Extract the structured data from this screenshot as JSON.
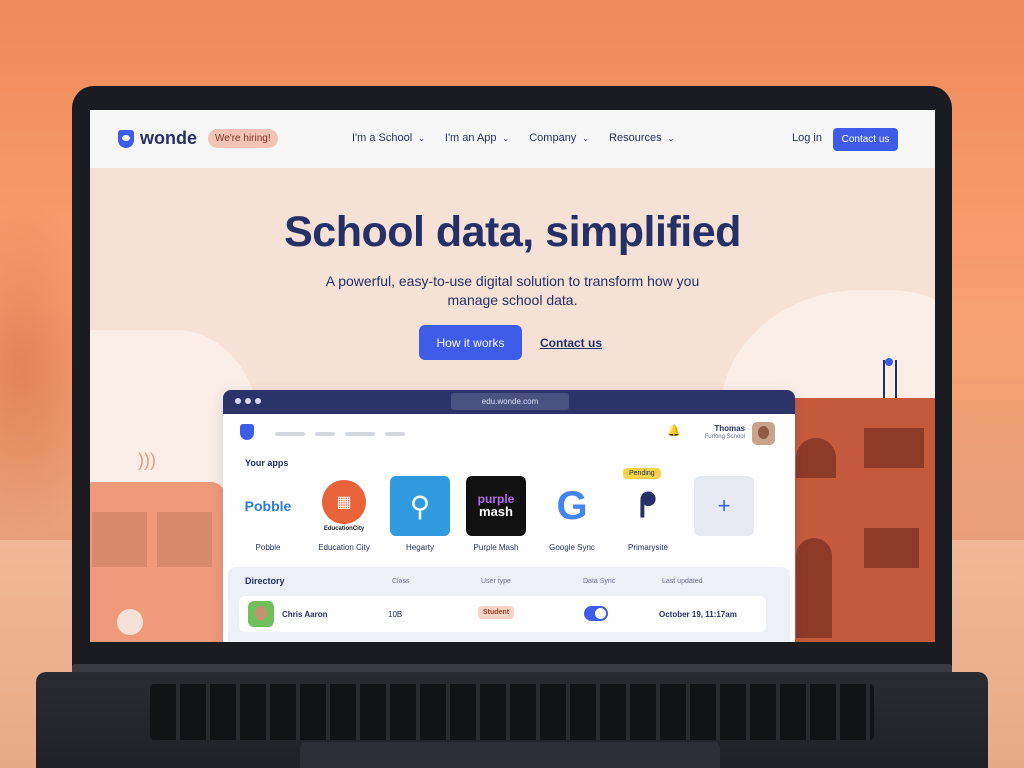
{
  "nav": {
    "brand": "wonde",
    "hiring_badge": "We're hiring!",
    "menu": [
      {
        "label": "I'm a School"
      },
      {
        "label": "I'm an App"
      },
      {
        "label": "Company"
      },
      {
        "label": "Resources"
      }
    ],
    "login": "Log in",
    "contact": "Contact us"
  },
  "hero": {
    "title": "School data, simplified",
    "subtitle": "A powerful, easy-to-use digital solution to transform how you manage school data.",
    "primary_button": "How it works",
    "secondary_link": "Contact us"
  },
  "app_window": {
    "url": "edu.wonde.com",
    "user_name": "Thomas",
    "user_school": "Furlong School",
    "apps_heading": "Your apps",
    "apps": [
      {
        "label": "Pobble",
        "icon": "pobble-logo",
        "icon_text": "Pobble"
      },
      {
        "label": "Education City",
        "icon": "educationcity-logo",
        "icon_text": "EducationCity"
      },
      {
        "label": "Hegarty",
        "icon": "hegarty-compass-icon"
      },
      {
        "label": "Purple Mash",
        "icon": "purple-mash-logo",
        "icon_text_top": "purple",
        "icon_text_bottom": "mash"
      },
      {
        "label": "Google Sync",
        "icon": "google-g-icon"
      },
      {
        "label": "Primarysite",
        "icon": "primarysite-logo",
        "status": "Pending"
      }
    ],
    "directory": {
      "title": "Directory",
      "columns": [
        "Class",
        "User type",
        "Data Sync",
        "Last updated"
      ],
      "rows": [
        {
          "name": "Chris Aaron",
          "class": "10B",
          "user_type": "Student",
          "data_sync": true,
          "last_updated": "October 19, 11:17am"
        }
      ]
    }
  },
  "colors": {
    "brand_blue": "#3e5ce8",
    "navy": "#253066",
    "hero_bg": "#f6e1d6"
  }
}
